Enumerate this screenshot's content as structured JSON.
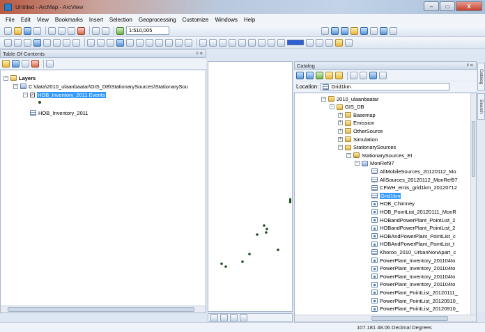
{
  "window": {
    "title": "Untitled - ArcMap - ArcView",
    "min": "–",
    "max": "□",
    "close": "X"
  },
  "menus": [
    "File",
    "Edit",
    "View",
    "Bookmarks",
    "Insert",
    "Selection",
    "Geoprocessing",
    "Customize",
    "Windows",
    "Help"
  ],
  "toolbar": {
    "scale": "1:510,005"
  },
  "toc": {
    "title": "Table Of Contents",
    "pin_close": "ᵖ ×",
    "layers_label": "Layers",
    "path": "C:\\data\\2010_ulaanbaatar\\GIS_DB\\StationarySources\\StationarySou",
    "events_layer": "HOB_Inventory_2011 Events",
    "table": "HOB_Inventory_2011"
  },
  "catalog": {
    "title": "Catalog",
    "pin_close": "ᵖ ×",
    "location_label": "Location:",
    "location_value": "Grid1km",
    "tree": [
      {
        "label": "2010_ulaanbaatar",
        "icon": "folder-icon",
        "exp": "−"
      },
      {
        "label": "GIS_DB",
        "icon": "folder-icon",
        "exp": "−"
      },
      {
        "label": "Basemap",
        "icon": "folder-icon",
        "exp": "+"
      },
      {
        "label": "Emission",
        "icon": "folder-icon",
        "exp": "+"
      },
      {
        "label": "OtherSource",
        "icon": "folder-icon",
        "exp": "+"
      },
      {
        "label": "Simulation",
        "icon": "folder-icon",
        "exp": "+"
      },
      {
        "label": "StationarySources",
        "icon": "folder-icon",
        "exp": "−"
      },
      {
        "label": "StationarySources_EI",
        "icon": "geodatabase-icon",
        "exp": "−"
      },
      {
        "label": "MonRef97",
        "icon": "feature-dataset-icon",
        "exp": "−"
      },
      {
        "label": "AllMobileSources_20120112_Mo",
        "icon": "polygon-feature-class-icon"
      },
      {
        "label": "AllSources_20120112_MonRef97",
        "icon": "polygon-feature-class-icon"
      },
      {
        "label": "CFWH_emis_grid1km_20120712",
        "icon": "polygon-feature-class-icon"
      },
      {
        "label": "Grid1km",
        "icon": "polygon-feature-class-icon",
        "selected": true
      },
      {
        "label": "HOB_Chimney",
        "icon": "point-feature-class-icon"
      },
      {
        "label": "HOB_PointList_20120111_MonR",
        "icon": "point-feature-class-icon"
      },
      {
        "label": "HOBandPowerPlant_PointList_2",
        "icon": "point-feature-class-icon"
      },
      {
        "label": "HOBandPowerPlant_PointList_2",
        "icon": "point-feature-class-icon"
      },
      {
        "label": "HOBAndPowerPlant_PointList_c",
        "icon": "point-feature-class-icon"
      },
      {
        "label": "HOBAndPowerPlant_PointList_t",
        "icon": "point-feature-class-icon"
      },
      {
        "label": "Khoroo_2010_UrbanNonApart_c",
        "icon": "polygon-feature-class-icon"
      },
      {
        "label": "PowerPlant_Inventory_201104to",
        "icon": "point-feature-class-icon"
      },
      {
        "label": "PowerPlant_Inventory_201104to",
        "icon": "point-feature-class-icon"
      },
      {
        "label": "PowerPlant_Inventory_201104to",
        "icon": "point-feature-class-icon"
      },
      {
        "label": "PowerPlant_Inventory_201104to",
        "icon": "point-feature-class-icon"
      },
      {
        "label": "PowerPlant_PointList_20120111_",
        "icon": "point-feature-class-icon"
      },
      {
        "label": "PowerPlant_PointList_20120910_",
        "icon": "point-feature-class-icon"
      },
      {
        "label": "PowerPlant_PointList_20120910_",
        "icon": "point-feature-class-icon"
      }
    ]
  },
  "side_tabs": [
    "Catalog",
    "Search"
  ],
  "status": {
    "coordinates": "107.181  48.06 Decimal Degrees"
  },
  "colors": {
    "selection": "#3399ff",
    "points": "#1e4d1e",
    "ramp": "#2d5fd6"
  }
}
